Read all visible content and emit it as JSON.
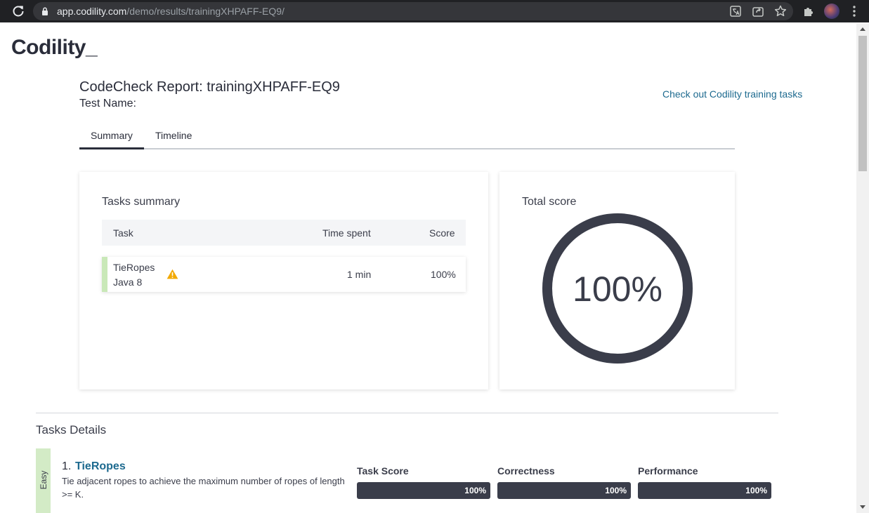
{
  "browser": {
    "url_host": "app.codility.com",
    "url_path": "/demo/results/trainingXHPAFF-EQ9/"
  },
  "brand": {
    "logo_text": "Codility_"
  },
  "header": {
    "title": "CodeCheck Report: trainingXHPAFF-EQ9",
    "test_name_label": "Test Name:",
    "training_link": "Check out Codility training tasks"
  },
  "tabs": [
    {
      "label": "Summary",
      "active": true
    },
    {
      "label": "Timeline",
      "active": false
    }
  ],
  "tasks_summary": {
    "title": "Tasks summary",
    "columns": [
      "Task",
      "Time spent",
      "Score"
    ],
    "rows": [
      {
        "task": "TieRopes",
        "language": "Java 8",
        "warning": "warning-icon",
        "time": "1 min",
        "score": "100%"
      }
    ]
  },
  "total_score": {
    "title": "Total score",
    "value": "100%",
    "fraction": 1.0
  },
  "tasks_details": {
    "title": "Tasks Details",
    "items": [
      {
        "difficulty": "Easy",
        "number": "1.",
        "name": "TieRopes",
        "description": "Tie adjacent ropes to achieve the maximum number of ropes of length >= K.",
        "metrics": [
          {
            "label": "Task Score",
            "value": "100%",
            "fraction": 1.0
          },
          {
            "label": "Correctness",
            "value": "100%",
            "fraction": 1.0
          },
          {
            "label": "Performance",
            "value": "100%",
            "fraction": 1.0
          }
        ]
      }
    ]
  },
  "colors": {
    "accent_link": "#1d6a8f",
    "dark": "#3a3d4a",
    "easy_badge": "#d3ebc6",
    "row_marker": "#c9e8b8",
    "warning": "#f2a900"
  }
}
